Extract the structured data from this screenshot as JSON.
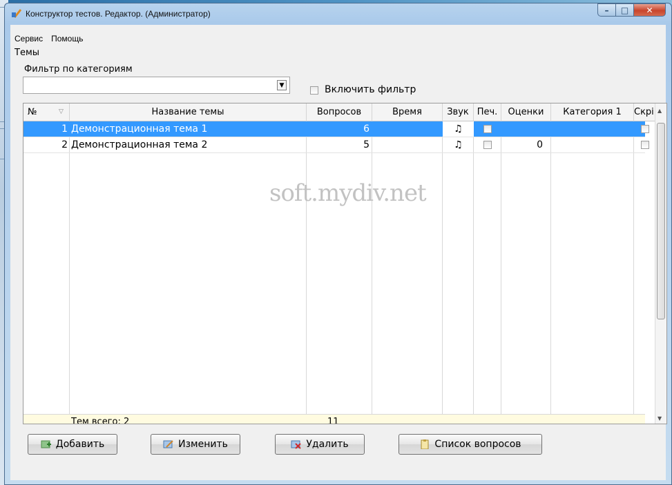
{
  "window": {
    "title": "Конструктор тестов. Редактор. (Администратор)"
  },
  "menu": [
    "Сервис",
    "Помощь"
  ],
  "section_label": "Темы",
  "filter": {
    "label": "Фильтр по категориям",
    "value": "",
    "enable_label": "Включить фильтр",
    "enabled": false
  },
  "grid": {
    "headers": [
      "№",
      "Название темы",
      "Вопросов",
      "Время",
      "Звук",
      "Печ.",
      "Оценки",
      "Категория 1",
      "Скрі"
    ],
    "rows": [
      {
        "num": "1",
        "name": "Демонстрационная тема 1",
        "questions": "6",
        "time": "",
        "sound": "♫",
        "grades": "",
        "category": "",
        "selected": true
      },
      {
        "num": "2",
        "name": "Демонстрационная тема 2",
        "questions": "5",
        "time": "",
        "sound": "♫",
        "grades": "0",
        "category": "",
        "selected": false
      }
    ],
    "footer": {
      "label": "Тем всего: 2",
      "total": "11"
    }
  },
  "buttons": {
    "add": "Добавить",
    "edit": "Изменить",
    "delete": "Удалить",
    "questions": "Список вопросов"
  },
  "watermark": "soft.mydiv.net",
  "colors": {
    "selection": "#3399ff",
    "footer_bg": "#fffbe0",
    "title_bar": "#a9c9ea"
  }
}
